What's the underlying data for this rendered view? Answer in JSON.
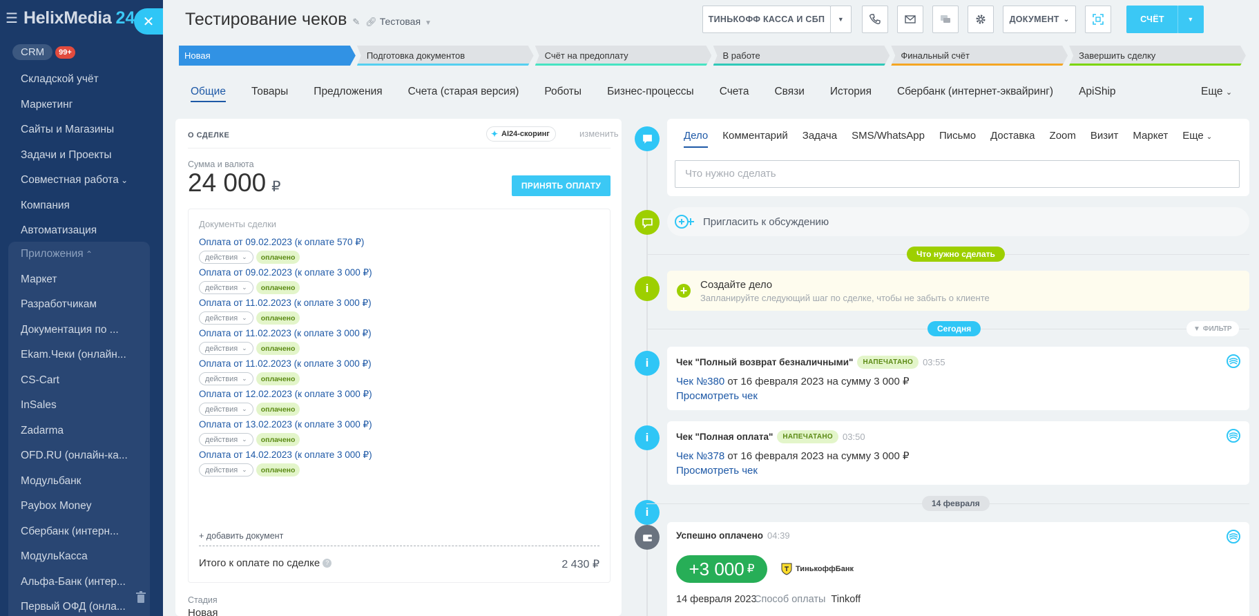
{
  "sidebar": {
    "brand": "HelixMedia",
    "brand_num": "24",
    "crm_label": "CRM",
    "crm_badge": "99+",
    "items": [
      "Складской учёт",
      "Маркетинг",
      "Сайты и Магазины",
      "Задачи и Проекты",
      "Совместная работа",
      "Компания",
      "Автоматизация"
    ],
    "apps_header": "Приложения",
    "apps": [
      "Маркет",
      "Разработчикам",
      "Документация по ...",
      "Ekam.Чеки (онлайн...",
      "CS-Cart",
      "InSales",
      "Zadarma",
      "OFD.RU (онлайн-ка...",
      "Модульбанк",
      "Paybox Money",
      "Сбербанк (интерн...",
      "МодульКасса",
      "Альфа-Банк (интер...",
      "Первый ОФД (онла..."
    ]
  },
  "header": {
    "title": "Тестирование чеков",
    "category": "Тестовая",
    "kassa_button": "ТИНЬКОФФ КАССА И СБП",
    "document_button": "ДОКУМЕНТ",
    "invoice_button": "СЧЁТ"
  },
  "stages": [
    {
      "label": "Новая",
      "color": "#3192e4"
    },
    {
      "label": "Подготовка документов",
      "color": "#55d0f0"
    },
    {
      "label": "Счёт на предоплату",
      "color": "#47e4c2"
    },
    {
      "label": "В работе",
      "color": "#2fc9b8"
    },
    {
      "label": "Финальный счёт",
      "color": "#f5a623"
    },
    {
      "label": "Завершить сделку",
      "color": "#7bd500"
    }
  ],
  "tabs": [
    "Общие",
    "Товары",
    "Предложения",
    "Счета (старая версия)",
    "Роботы",
    "Бизнес-процессы",
    "Счета",
    "Связи",
    "История",
    "Сбербанк (интернет-эквайринг)",
    "ApiShip"
  ],
  "tabs_more": "Еще",
  "deal": {
    "header": "О СДЕЛКЕ",
    "ai_label": "AI24-скоринг",
    "edit_label": "изменить",
    "sum_label": "Сумма и валюта",
    "sum_value": "24 000",
    "currency": "₽",
    "accept_button": "ПРИНЯТЬ ОПЛАТУ",
    "docs_title": "Документы сделки",
    "docs": [
      {
        "link": "Оплата от 09.02.2023 (к оплате 570 ₽)"
      },
      {
        "link": "Оплата от 09.02.2023 (к оплате 3 000 ₽)"
      },
      {
        "link": "Оплата от 11.02.2023 (к оплате 3 000 ₽)"
      },
      {
        "link": "Оплата от 11.02.2023 (к оплате 3 000 ₽)"
      },
      {
        "link": "Оплата от 11.02.2023 (к оплате 3 000 ₽)"
      },
      {
        "link": "Оплата от 12.02.2023 (к оплате 3 000 ₽)"
      },
      {
        "link": "Оплата от 13.02.2023 (к оплате 3 000 ₽)"
      },
      {
        "link": "Оплата от 14.02.2023 (к оплате 3 000 ₽)"
      }
    ],
    "actions_label": "действия",
    "paid_label": "оплачено",
    "add_doc": "+ добавить документ",
    "total_label": "Итого к оплате по сделке",
    "total_value": "2 430 ₽",
    "stage_label": "Стадия",
    "stage_value": "Новая"
  },
  "editor": {
    "tabs": [
      "Дело",
      "Комментарий",
      "Задача",
      "SMS/WhatsApp",
      "Письмо",
      "Доставка",
      "Zoom",
      "Визит",
      "Маркет"
    ],
    "more": "Еще",
    "placeholder": "Что нужно сделать"
  },
  "timeline": {
    "invite": "Пригласить к обсуждению",
    "todo_pill": "Что нужно сделать",
    "create_title": "Создайте дело",
    "create_sub": "Запланируйте следующий шаг по сделке, чтобы не забыть о клиенте",
    "today_pill": "Сегодня",
    "filter": "ФИЛЬТР",
    "receipt1": {
      "title": "Чек \"Полный возврат безналичными\"",
      "badge": "НАПЕЧАТАНО",
      "time": "03:55",
      "link": "Чек №380",
      "text": " от 16 февраля 2023 на сумму 3 000 ₽",
      "view": "Просмотреть чек"
    },
    "receipt2": {
      "title": "Чек \"Полная оплата\"",
      "badge": "НАПЕЧАТАНО",
      "time": "03:50",
      "link": "Чек №378",
      "text": " от 16 февраля 2023 на сумму 3 000 ₽",
      "view": "Просмотреть чек"
    },
    "date_pill": "14 февраля",
    "payment": {
      "title": "Успешно оплачено",
      "time": "04:39",
      "amount": "+3 000",
      "currency": "₽",
      "bank": "ТинькоффБанк",
      "date": "14 февраля 2023",
      "method_label": "Способ оплаты",
      "method": "Tinkoff"
    }
  }
}
